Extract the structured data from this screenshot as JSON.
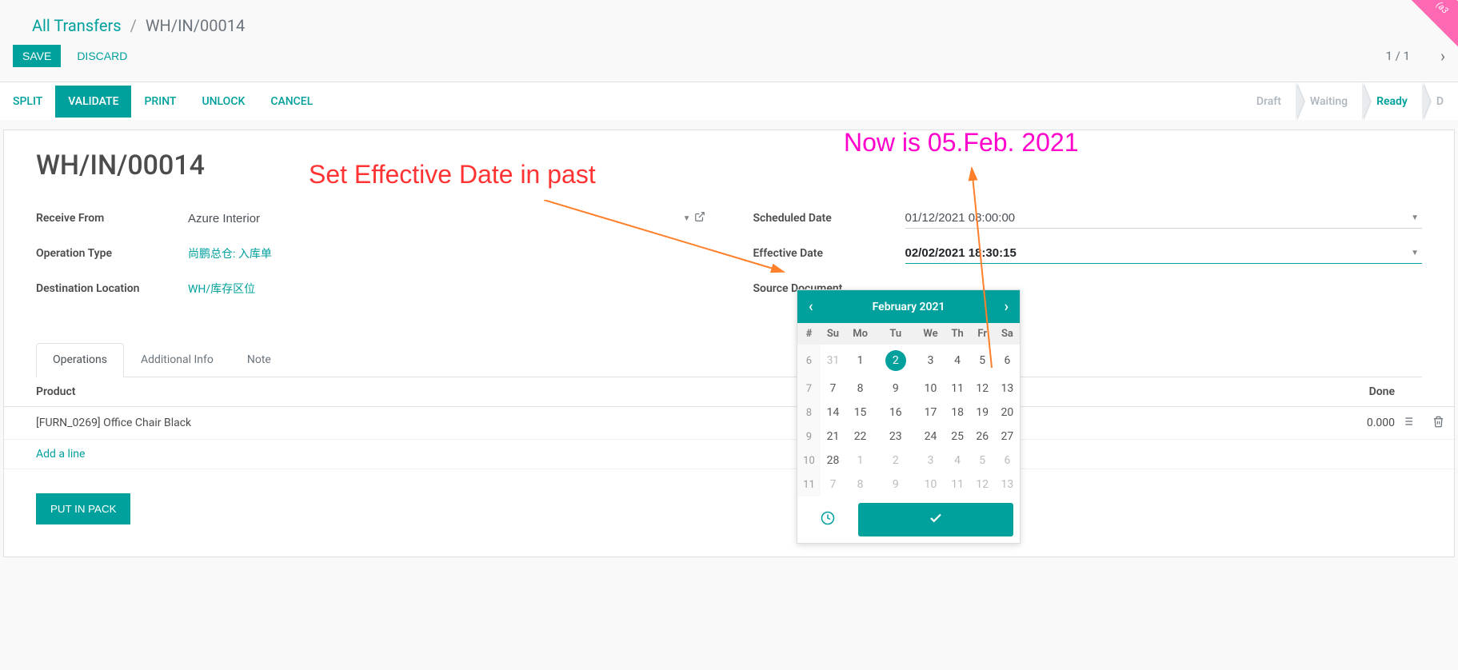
{
  "ribbon": "(a3",
  "breadcrumb": {
    "root": "All Transfers",
    "sep": "/",
    "current": "WH/IN/00014"
  },
  "actions": {
    "save": "Save",
    "discard": "Discard"
  },
  "pager": "1 / 1",
  "toolbar": {
    "split": "Split",
    "validate": "Validate",
    "print": "Print",
    "unlock": "Unlock",
    "cancel": "Cancel"
  },
  "status": {
    "draft": "Draft",
    "waiting": "Waiting",
    "ready": "Ready",
    "done": "D"
  },
  "title": "WH/IN/00014",
  "fields": {
    "receive_from_label": "Receive From",
    "receive_from_value": "Azure Interior",
    "operation_type_label": "Operation Type",
    "operation_type_value": "尚鹏总仓: 入库单",
    "destination_location_label": "Destination Location",
    "destination_location_value": "WH/库存区位",
    "scheduled_date_label": "Scheduled Date",
    "scheduled_date_value": "01/12/2021 08:00:00",
    "effective_date_label": "Effective Date",
    "effective_date_value": "02/02/2021 18:30:15",
    "source_document_label": "Source Document",
    "source_document_value": ""
  },
  "tabs": {
    "operations": "Operations",
    "additional_info": "Additional Info",
    "note": "Note"
  },
  "table": {
    "product_header": "Product",
    "done_header": "Done",
    "rows": [
      {
        "product": "[FURN_0269] Office Chair Black",
        "done": "0.000"
      }
    ],
    "add_line": "Add a line"
  },
  "put_in_pack": "PUT IN PACK",
  "calendar": {
    "month_label": "February 2021",
    "week_header": "#",
    "days": [
      "Su",
      "Mo",
      "Tu",
      "We",
      "Th",
      "Fr",
      "Sa"
    ],
    "weeks": [
      {
        "wk": "6",
        "cells": [
          {
            "d": "31",
            "muted": true
          },
          {
            "d": "1"
          },
          {
            "d": "2",
            "sel": true
          },
          {
            "d": "3"
          },
          {
            "d": "4"
          },
          {
            "d": "5"
          },
          {
            "d": "6"
          }
        ]
      },
      {
        "wk": "7",
        "cells": [
          {
            "d": "7"
          },
          {
            "d": "8"
          },
          {
            "d": "9"
          },
          {
            "d": "10"
          },
          {
            "d": "11"
          },
          {
            "d": "12"
          },
          {
            "d": "13"
          }
        ]
      },
      {
        "wk": "8",
        "cells": [
          {
            "d": "14"
          },
          {
            "d": "15"
          },
          {
            "d": "16"
          },
          {
            "d": "17"
          },
          {
            "d": "18"
          },
          {
            "d": "19"
          },
          {
            "d": "20"
          }
        ]
      },
      {
        "wk": "9",
        "cells": [
          {
            "d": "21"
          },
          {
            "d": "22"
          },
          {
            "d": "23"
          },
          {
            "d": "24"
          },
          {
            "d": "25"
          },
          {
            "d": "26"
          },
          {
            "d": "27"
          }
        ]
      },
      {
        "wk": "10",
        "cells": [
          {
            "d": "28"
          },
          {
            "d": "1",
            "muted": true
          },
          {
            "d": "2",
            "muted": true
          },
          {
            "d": "3",
            "muted": true
          },
          {
            "d": "4",
            "muted": true
          },
          {
            "d": "5",
            "muted": true
          },
          {
            "d": "6",
            "muted": true
          }
        ]
      },
      {
        "wk": "11",
        "cells": [
          {
            "d": "7",
            "muted": true
          },
          {
            "d": "8",
            "muted": true
          },
          {
            "d": "9",
            "muted": true
          },
          {
            "d": "10",
            "muted": true
          },
          {
            "d": "11",
            "muted": true
          },
          {
            "d": "12",
            "muted": true
          },
          {
            "d": "13",
            "muted": true
          }
        ]
      }
    ]
  },
  "annotations": {
    "a1": "Set Effective Date in past",
    "a2": "Now is 05.Feb. 2021"
  }
}
